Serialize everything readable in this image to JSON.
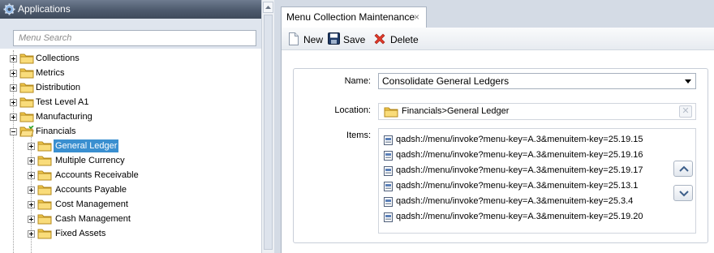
{
  "sidebar": {
    "title": "Applications",
    "search_placeholder": "Menu Search",
    "tree": [
      {
        "label": "Collections"
      },
      {
        "label": "Metrics"
      },
      {
        "label": "Distribution"
      },
      {
        "label": "Test Level A1"
      },
      {
        "label": "Manufacturing"
      },
      {
        "label": "Financials"
      },
      {
        "label": "General Ledger"
      },
      {
        "label": "Multiple Currency"
      },
      {
        "label": "Accounts Receivable"
      },
      {
        "label": "Accounts Payable"
      },
      {
        "label": "Cost Management"
      },
      {
        "label": "Cash Management"
      },
      {
        "label": "Fixed Assets"
      }
    ]
  },
  "tab": {
    "label": "Menu Collection Maintenance",
    "close": "×"
  },
  "toolbar": {
    "new_label": "New",
    "save_label": "Save",
    "delete_label": "Delete"
  },
  "form": {
    "name_label": "Name:",
    "name_value": "Consolidate  General Ledgers",
    "location_label": "Location:",
    "location_value": "Financials>General Ledger",
    "items_label": "Items:",
    "items": [
      "qadsh://menu/invoke?menu-key=A.3&menuitem-key=25.19.15",
      "qadsh://menu/invoke?menu-key=A.3&menuitem-key=25.19.16",
      "qadsh://menu/invoke?menu-key=A.3&menuitem-key=25.19.17",
      "qadsh://menu/invoke?menu-key=A.3&menuitem-key=25.13.1",
      "qadsh://menu/invoke?menu-key=A.3&menuitem-key=25.3.4",
      "qadsh://menu/invoke?menu-key=A.3&menuitem-key=25.19.20"
    ]
  },
  "colors": {
    "selection": "#3a8fd0",
    "header": "#4d5a6d",
    "folder": "#f2c94c",
    "delete": "#e03a2a"
  }
}
